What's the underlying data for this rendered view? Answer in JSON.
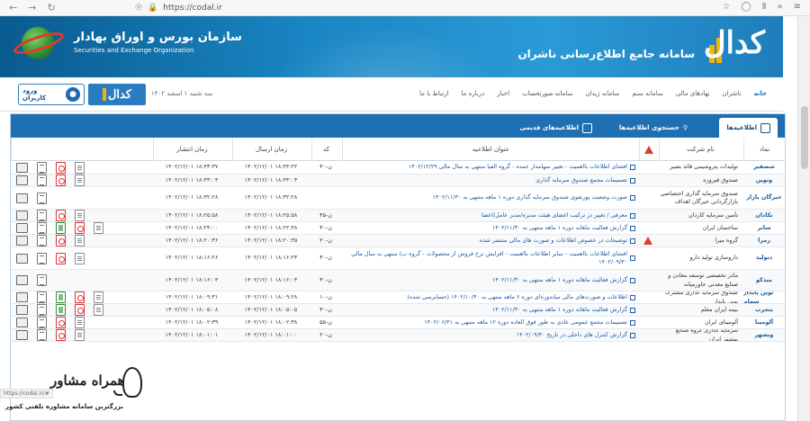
{
  "browser": {
    "url": "https://codal.ir",
    "icons": [
      "back-icon",
      "forward-icon",
      "reload-icon",
      "shield-icon",
      "lock-icon",
      "star-icon",
      "pocket-icon",
      "library-icon",
      "extensions-icon",
      "menu-icon"
    ]
  },
  "banner": {
    "org_fa": "سازمان بورس و اوراق بهادار",
    "org_en": "Securities and Exchange Organization",
    "site_title": "سامانه جامع اطلاع‌رسانی ناشران",
    "logo_word": "کدال"
  },
  "topnav": {
    "login_label": "ورود کاربران",
    "codal_label": "کدال",
    "date": "سه شنبه ۱ اسفند ۱۴۰۲",
    "menu": [
      {
        "label": "خانه",
        "active": true
      },
      {
        "label": "ناشران",
        "active": false
      },
      {
        "label": "نهادهای مالی",
        "active": false
      },
      {
        "label": "سامانه سنم",
        "active": false
      },
      {
        "label": "سامانه ژیدان",
        "active": false
      },
      {
        "label": "سامانه صورتحساب",
        "active": false
      },
      {
        "label": "اخبار",
        "active": false
      },
      {
        "label": "درباره ما",
        "active": false
      },
      {
        "label": "ارتباط با ما",
        "active": false
      }
    ]
  },
  "tabs": [
    {
      "label": "اطلاعیه‌ها",
      "active": true
    },
    {
      "label": "جستجوی اطلاعیه‌ها",
      "active": false
    },
    {
      "label": "اطلاعیه‌های قدیمی",
      "active": false
    }
  ],
  "columns": {
    "symbol": "نماد",
    "company": "نام شرکت",
    "title": "عنوان اطلاعیه",
    "code": "کد",
    "sent": "زمان ارسال",
    "published": "زمان انتشار"
  },
  "rows": [
    {
      "symbol": "شصفیر",
      "company": "تولیدات پتروشیمی قائد بصیر",
      "warn": false,
      "title": "افشای اطلاعات بااهمیت - تغییر سهامدار عمده - گروه الفبا منتهی به سال مالی ۱۴۰۲/۱۲/۲۹",
      "code": "ن-۳۰",
      "sent": "۱۴۰۲/۱۲/۰۱ ۱۸:۴۳:۲۲",
      "published": "۱۴۰۲/۱۲/۰۱ ۱۸:۴۳:۳۷",
      "actions": [
        "mon",
        "att",
        "pdf",
        "doc"
      ]
    },
    {
      "symbol": "ونوین",
      "company": "صندوق فیروزه",
      "warn": false,
      "title": "تصمیمات مجمع صندوق سرمایه گذاری",
      "code": "",
      "sent": "۱۴۰۲/۱۲/۰۱ ۱۸:۴۳:۰۳",
      "published": "۱۴۰۲/۱۲/۰۱ ۱۸:۴۳:۰۴",
      "actions": [
        "mon",
        "att",
        "pdf",
        "doc"
      ]
    },
    {
      "symbol": "خبرگان بازار",
      "company": "صندوق سرمایه گذاری اختصاصی بازارگردانی خبرگان اهداف",
      "warn": false,
      "title": "صورت وضعیت پورتفوی صندوق سرمایه گذاری دوره ۱ ماهه منتهی به ۱۴۰۲/۱۱/۳۰",
      "code": "",
      "sent": "۱۴۰۲/۱۲/۰۱ ۱۸:۳۲:۲۸",
      "published": "۱۴۰۲/۱۲/۰۱ ۱۸:۳۲:۲۸",
      "actions": [
        "mon",
        "att"
      ]
    },
    {
      "symbol": "تکادان",
      "company": "تأمین سرمایه کاردان",
      "warn": false,
      "title": "معرفی / تغییر در ترکیب اعضای هیئت مدیره/مدیر عامل/اعضا",
      "code": "ن-۴۵",
      "sent": "۱۴۰۲/۱۲/۰۱ ۱۸:۲۵:۵۸",
      "published": "۱۴۰۲/۱۲/۰۱ ۱۸:۲۵:۵۸",
      "actions": [
        "mon",
        "att",
        "pdf",
        "doc"
      ]
    },
    {
      "symbol": "ساتر",
      "company": "ساختمان ایران",
      "warn": false,
      "title": "گزارش فعالیت ماهانه دوره ۱ ماهه منتهی به ۱۴۰۲/۱۱/۳۰",
      "code": "ن-۳۰",
      "sent": "۱۴۰۲/۱۲/۰۱ ۱۸:۲۲:۴۸",
      "published": "۱۴۰۲/۱۲/۰۱ ۱۸:۲۴:۰۰",
      "actions": [
        "mon",
        "att",
        "xls",
        "pdf",
        "doc"
      ]
    },
    {
      "symbol": "زمرا",
      "company": "گروه میرا",
      "warn": true,
      "title": "توضیحات در خصوص اطلاعات و صورت های مالی منتشر شده",
      "code": "ن-۲۰",
      "sent": "۱۴۰۲/۱۲/۰۱ ۱۸:۲۰:۳۵",
      "published": "۱۴۰۲/۱۲/۰۱ ۱۸:۲۰:۳۶",
      "actions": [
        "mon",
        "att",
        "pdf",
        "doc"
      ]
    },
    {
      "symbol": "دتولید",
      "company": "داروسازی تولید دارو",
      "warn": false,
      "title": "افشای اطلاعات بااهمیت - سایر اطلاعات بااهمیت - افزایش نرخ فروش از محصولات - گروه ب) منتهی به سال مالی ۱۴۰۲/۰۹/۳۰",
      "code": "ن-۳۰",
      "sent": "۱۴۰۲/۱۲/۰۱ ۱۸:۱۶:۲۳",
      "published": "۱۴۰۲/۱۲/۰۱ ۱۸:۱۶:۲۶",
      "actions": [
        "mon",
        "att",
        "pdf",
        "doc"
      ]
    },
    {
      "symbol": "میدکو",
      "company": "مادر تخصصی توسعه معادن و صنایع معدنی خاورمیانه",
      "warn": false,
      "title": "گزارش فعالیت ماهانه دوره ۱ ماهه منتهی به ۱۴۰۲/۱۱/۳۰",
      "code": "ن-۳۰",
      "sent": "۱۴۰۲/۱۲/۰۱ ۱۸:۱۶:۰۳",
      "published": "۱۴۰۲/۱۲/۰۱ ۱۸:۱۶:۰۳",
      "actions": [
        "mon",
        "att"
      ]
    },
    {
      "symbol": "نوین پایدار سهام",
      "company": "صندوق سرمایه گذاری مشترک نوین پایدار",
      "warn": false,
      "title": "اطلاعات و صورت‌های مالی میاندوره‌ای دوره ۶ ماهه منتهی به ۱۴۰۲/۱۰/۳۰ (حسابرسی شده)",
      "code": "ن-۱۰",
      "sent": "۱۴۰۲/۱۲/۰۱ ۱۸:۰۹:۲۸",
      "published": "۱۴۰۲/۱۲/۰۱ ۱۸:۰۹:۳۱",
      "actions": [
        "mon",
        "att",
        "xls",
        "pdf",
        "doc"
      ]
    },
    {
      "symbol": "بتجرب",
      "company": "بیمه ایران معلم",
      "warn": false,
      "title": "گزارش فعالیت ماهانه دوره ۱ ماهه منتهی به ۱۴۰۲/۱۱/۳۰",
      "code": "ن-۳۰",
      "sent": "۱۴۰۲/۱۲/۰۱ ۱۸:۰۵:۰۵",
      "published": "۱۴۰۲/۱۲/۰۱ ۱۸:۰۵:۰۸",
      "actions": [
        "mon",
        "att",
        "xls",
        "pdf",
        "doc"
      ]
    },
    {
      "symbol": "آلومینا",
      "company": "آلومینای ایران",
      "warn": false,
      "title": "تصمیمات مجمع عمومی عادی به طور فوق العاده دوره ۱۲ ماهه منتهی به ۱۴۰۲/۰۶/۳۱",
      "code": "ن-۵۵",
      "sent": "۱۴۰۲/۱۲/۰۱ ۱۸:۰۲:۳۸",
      "published": "۱۴۰۲/۱۲/۰۱ ۱۸:۰۲:۳۹",
      "actions": [
        "mon",
        "att",
        "pdf",
        "doc"
      ]
    },
    {
      "symbol": "وبشهر",
      "company": "سرمایه گذاری گروه صنایع بهشهر ایران",
      "warn": false,
      "title": "گزارش کنترل های داخلی در تاریخ ۱۴۰۲/۰۹/۳۰",
      "code": "ن-۲۰",
      "sent": "۱۴۰۲/۱۲/۰۱ ۱۸:۰۱:۰۰",
      "published": "۱۴۰۲/۱۲/۰۱ ۱۸:۰۱:۰۱",
      "actions": [
        "mon",
        "att",
        "pdf",
        "doc"
      ]
    }
  ],
  "watermark": {
    "title": "همراه مشاور",
    "subtitle": "بزرگترین سامانه مشاوره تلفنی کشور"
  },
  "status_url": "https://codal.ir/#"
}
